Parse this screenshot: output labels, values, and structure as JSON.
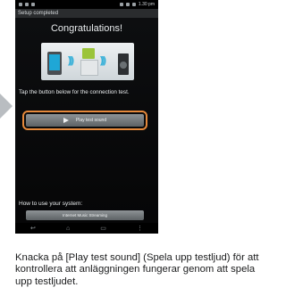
{
  "status_bar": {
    "time": "1.30 pm",
    "left_icons": [
      "settings-icon",
      "usb-icon",
      "image-icon"
    ],
    "right_icons": [
      "signal-icon",
      "wifi-icon",
      "battery-icon"
    ]
  },
  "app": {
    "title": "Setup completed",
    "heading": "Congratulations!",
    "instruction": "Tap the button below for the connection test.",
    "play_button_label": "Play test sound",
    "howto_label": "How to use your system:",
    "internet_button_label": "Internet Music Streaming"
  },
  "nav_bar": {
    "back_glyph": "↩",
    "home_glyph": "⌂",
    "recent_glyph": "▭",
    "menu_glyph": "⋮"
  },
  "caption": {
    "text": "Knacka på [Play test sound] (Spela upp testljud) för att kontrollera att anläggningen fungerar genom att spela upp testljudet."
  },
  "colors": {
    "highlight_ring": "#e6893b",
    "pointer_arrow": "#b9bdc1",
    "screen_bg": "#0d0e10"
  }
}
